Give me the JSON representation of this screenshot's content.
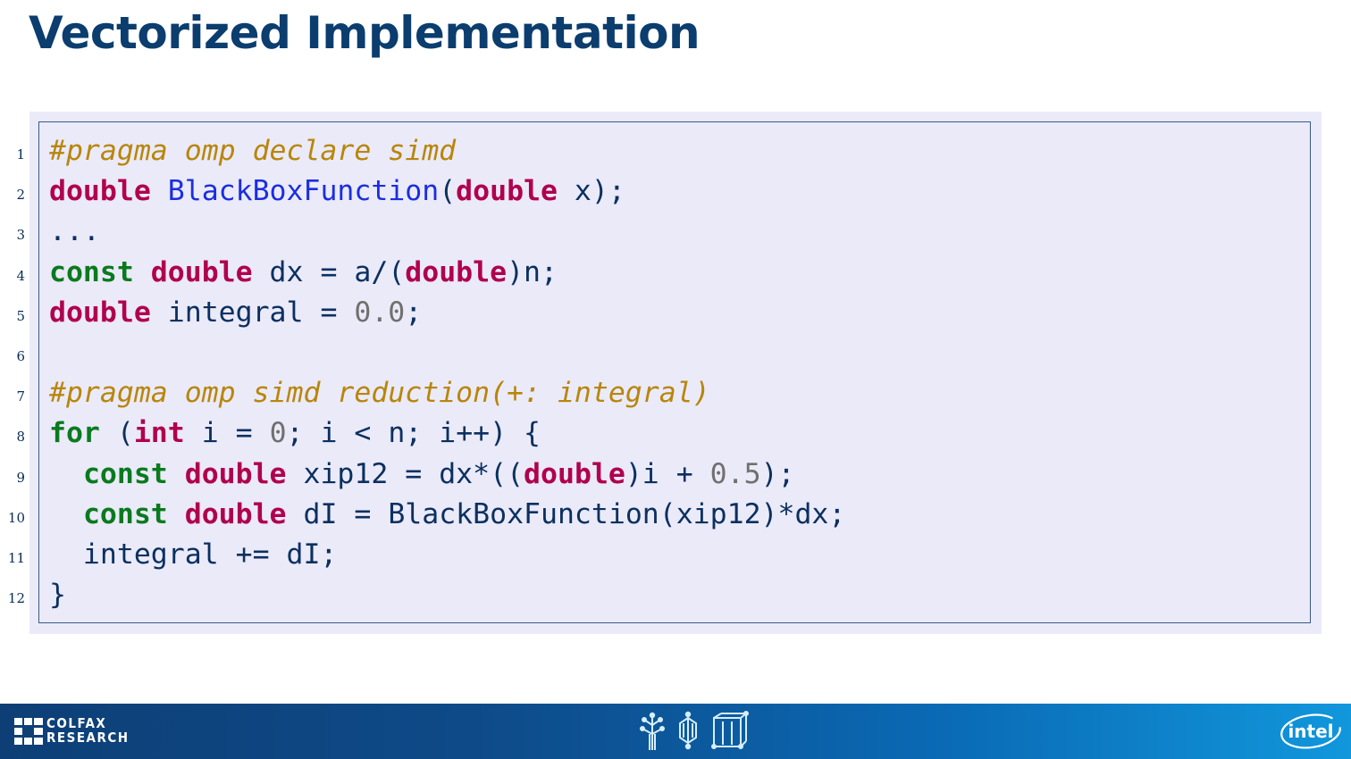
{
  "slide": {
    "title": "Vectorized Implementation"
  },
  "code": {
    "lines": [
      {
        "num": "1",
        "text": "#pragma omp declare simd"
      },
      {
        "num": "2",
        "text": "double BlackBoxFunction(double x);"
      },
      {
        "num": "3",
        "text": "..."
      },
      {
        "num": "4",
        "text": "const double dx = a/(double)n;"
      },
      {
        "num": "5",
        "text": "double integral = 0.0;"
      },
      {
        "num": "6",
        "text": ""
      },
      {
        "num": "7",
        "text": "#pragma omp simd reduction(+: integral)"
      },
      {
        "num": "8",
        "text": "for (int i = 0; i < n; i++) {"
      },
      {
        "num": "9",
        "text": "  const double xip12 = dx*((double)i + 0.5);"
      },
      {
        "num": "10",
        "text": "  const double dI = BlackBoxFunction(xip12)*dx;"
      },
      {
        "num": "11",
        "text": "  integral += dI;"
      },
      {
        "num": "12",
        "text": "}"
      }
    ]
  },
  "footer": {
    "left_logo_line1": "COLFAX",
    "left_logo_line2": "RESEARCH",
    "right_logo": "intel",
    "center_icons": [
      "tree-icon",
      "hexagon-icon",
      "cube-icon"
    ]
  },
  "colors": {
    "title": "#0b3d6e",
    "code_background": "#ebeaf8",
    "type_keyword": "#b0004e",
    "control_keyword": "#0a7a1e",
    "function_name": "#1a2ee0",
    "pragma": "#b8860b",
    "number": "#707070"
  }
}
